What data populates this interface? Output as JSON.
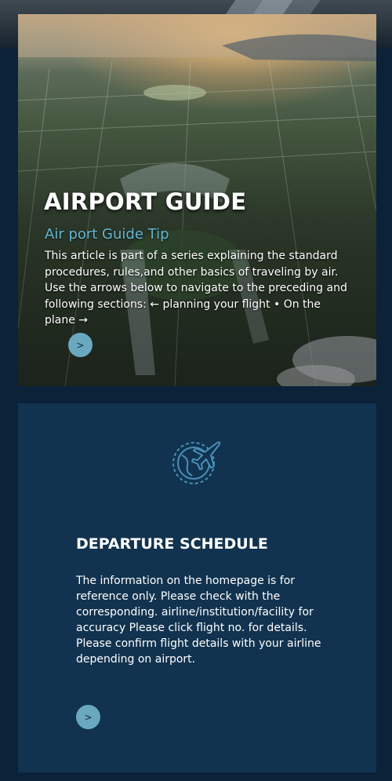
{
  "hero": {
    "title": "AIRPORT GUIDE",
    "subtitle": "Air port Guide Tip",
    "body": "This article is part of a series explaining the standard procedures, rules,and other basics of traveling by air. Use the arrows below to navigate to the preceding and following sections: ← planning your flight • On the plane →",
    "button_label": ">"
  },
  "departure": {
    "icon": "globe-airplane-icon",
    "title": "DEPARTURE SCHEDULE",
    "body": "The information on the homepage is for reference only. Please check with the corresponding. airline/institution/facility for accuracy Please click flight no. for details. Please confirm flight details with your airline depending on airport.",
    "button_label": ">"
  },
  "colors": {
    "page_background": "#0b2238",
    "card_background": "#11334f",
    "accent": "#62b7d3",
    "button": "#6aa8c0",
    "text": "#ffffff"
  }
}
